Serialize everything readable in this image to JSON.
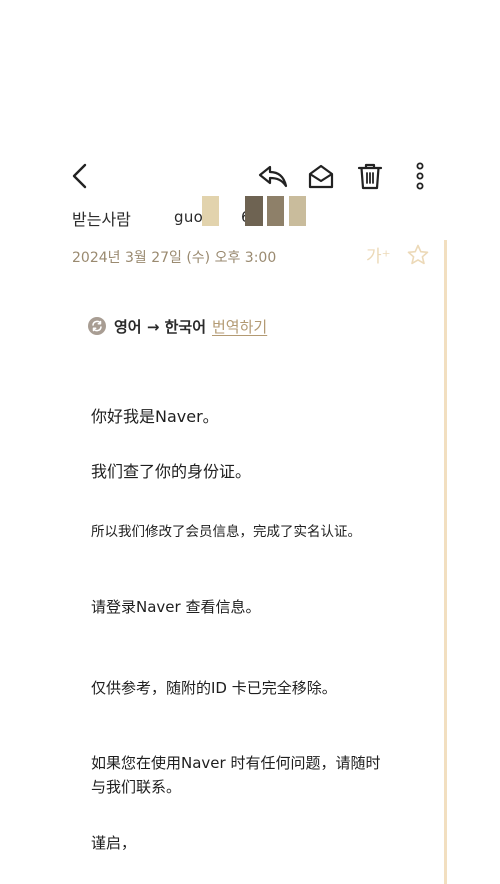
{
  "toolbar": {
    "back": "back-icon",
    "reply_all": "reply-all-icon",
    "mark_unread": "open-envelope-icon",
    "delete": "trash-icon",
    "more": "more-vertical-icon"
  },
  "recipient": {
    "label": "받는사람",
    "address": "guo",
    "address_tail": "6"
  },
  "meta": {
    "date": "2024년 3월 27일 (수) 오후 3:00",
    "font_size_label": "가⁺"
  },
  "translate": {
    "languages": "영어 → 한국어",
    "action": "번역하기"
  },
  "body": {
    "line1": "你好我是Naver。",
    "line2": "我们查了你的身份证。",
    "line3": "所以我们修改了会员信息，完成了实名认证。",
    "line4": "请登录Naver 查看信息。",
    "line5": "仅供参考，随附的ID 卡已完全移除。",
    "line6": "如果您在使用Naver 时有任何问题，请随时",
    "line7": "与我们联系。",
    "line8": "谨启，"
  },
  "colors": {
    "accent": "#f2dfc0",
    "date": "#9a8a70",
    "link": "#b39a73",
    "redact_light": "#e2d3ad",
    "redact_dark": "#6e6352",
    "redact_mid": "#8e8069",
    "redact_tan": "#c9bc9c"
  }
}
